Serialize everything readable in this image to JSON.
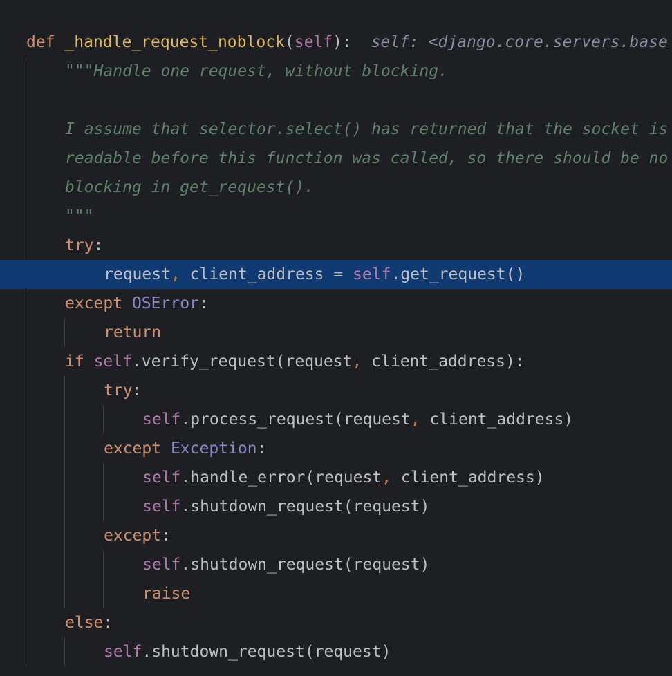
{
  "editor": {
    "language": "python",
    "colors": {
      "background": "#1e1f22",
      "current_line": "#0f3a72",
      "keyword": "#cf8e6d",
      "self": "#b07aa8",
      "class": "#8888c6",
      "docstring": "#5f826b",
      "inlay_hint": "#8c8ea0",
      "text": "#bcbec4"
    },
    "lines": [
      {
        "id": "def",
        "tokens": [
          {
            "t": "def",
            "c": "kw"
          },
          {
            "t": " ",
            "c": "plain"
          },
          {
            "t": "_handle_request_noblock",
            "c": "fn-def"
          },
          {
            "t": "(",
            "c": "plain"
          },
          {
            "t": "self",
            "c": "self"
          },
          {
            "t": "):",
            "c": "plain"
          },
          {
            "t": "  ",
            "c": "plain"
          },
          {
            "t": "self: <django.core.servers.base",
            "c": "hint"
          }
        ]
      },
      {
        "id": "doc1",
        "tokens": [
          {
            "t": "\"\"\"Handle one request, without blocking.",
            "c": "doc"
          }
        ]
      },
      {
        "id": "blank",
        "tokens": []
      },
      {
        "id": "doc2",
        "tokens": [
          {
            "t": "I assume that selector.select() has returned that the socket is",
            "c": "doc"
          }
        ]
      },
      {
        "id": "doc3",
        "tokens": [
          {
            "t": "readable before this function was called, so there should be no",
            "c": "doc"
          }
        ]
      },
      {
        "id": "doc4",
        "tokens": [
          {
            "t": "blocking in get_request().",
            "c": "doc"
          }
        ]
      },
      {
        "id": "doc5",
        "tokens": [
          {
            "t": "\"\"\"",
            "c": "doc"
          }
        ]
      },
      {
        "id": "try1",
        "tokens": [
          {
            "t": "try",
            "c": "kw"
          },
          {
            "t": ":",
            "c": "plain"
          }
        ]
      },
      {
        "id": "get_request",
        "current": true,
        "tokens": [
          {
            "t": "request",
            "c": "plain"
          },
          {
            "t": ",",
            "c": "comma"
          },
          {
            "t": " client_address = ",
            "c": "plain"
          },
          {
            "t": "self",
            "c": "self"
          },
          {
            "t": ".get_request()",
            "c": "plain"
          }
        ]
      },
      {
        "id": "except_oserror",
        "tokens": [
          {
            "t": "except",
            "c": "kw"
          },
          {
            "t": " ",
            "c": "plain"
          },
          {
            "t": "OSError",
            "c": "cls"
          },
          {
            "t": ":",
            "c": "plain"
          }
        ]
      },
      {
        "id": "return",
        "tokens": [
          {
            "t": "return",
            "c": "kw"
          }
        ]
      },
      {
        "id": "if_verify",
        "tokens": [
          {
            "t": "if",
            "c": "kw"
          },
          {
            "t": " ",
            "c": "plain"
          },
          {
            "t": "self",
            "c": "self"
          },
          {
            "t": ".verify_request(request",
            "c": "plain"
          },
          {
            "t": ",",
            "c": "comma"
          },
          {
            "t": " client_address):",
            "c": "plain"
          }
        ]
      },
      {
        "id": "try2",
        "tokens": [
          {
            "t": "try",
            "c": "kw"
          },
          {
            "t": ":",
            "c": "plain"
          }
        ]
      },
      {
        "id": "process_request",
        "tokens": [
          {
            "t": "self",
            "c": "self"
          },
          {
            "t": ".process_request(request",
            "c": "plain"
          },
          {
            "t": ",",
            "c": "comma"
          },
          {
            "t": " client_address)",
            "c": "plain"
          }
        ]
      },
      {
        "id": "except_exception",
        "tokens": [
          {
            "t": "except",
            "c": "kw"
          },
          {
            "t": " ",
            "c": "plain"
          },
          {
            "t": "Exception",
            "c": "cls"
          },
          {
            "t": ":",
            "c": "plain"
          }
        ]
      },
      {
        "id": "handle_error",
        "tokens": [
          {
            "t": "self",
            "c": "self"
          },
          {
            "t": ".handle_error(request",
            "c": "plain"
          },
          {
            "t": ",",
            "c": "comma"
          },
          {
            "t": " client_address)",
            "c": "plain"
          }
        ]
      },
      {
        "id": "shutdown1",
        "tokens": [
          {
            "t": "self",
            "c": "self"
          },
          {
            "t": ".shutdown_request(request)",
            "c": "plain"
          }
        ]
      },
      {
        "id": "except_bare",
        "tokens": [
          {
            "t": "except",
            "c": "kw"
          },
          {
            "t": ":",
            "c": "plain"
          }
        ]
      },
      {
        "id": "shutdown2",
        "tokens": [
          {
            "t": "self",
            "c": "self"
          },
          {
            "t": ".shutdown_request(request)",
            "c": "plain"
          }
        ]
      },
      {
        "id": "raise",
        "tokens": [
          {
            "t": "raise",
            "c": "kw"
          }
        ]
      },
      {
        "id": "else",
        "tokens": [
          {
            "t": "else",
            "c": "kw"
          },
          {
            "t": ":",
            "c": "plain"
          }
        ]
      },
      {
        "id": "shutdown3",
        "tokens": [
          {
            "t": "self",
            "c": "self"
          },
          {
            "t": ".shutdown_request(request)",
            "c": "plain"
          }
        ]
      }
    ]
  }
}
